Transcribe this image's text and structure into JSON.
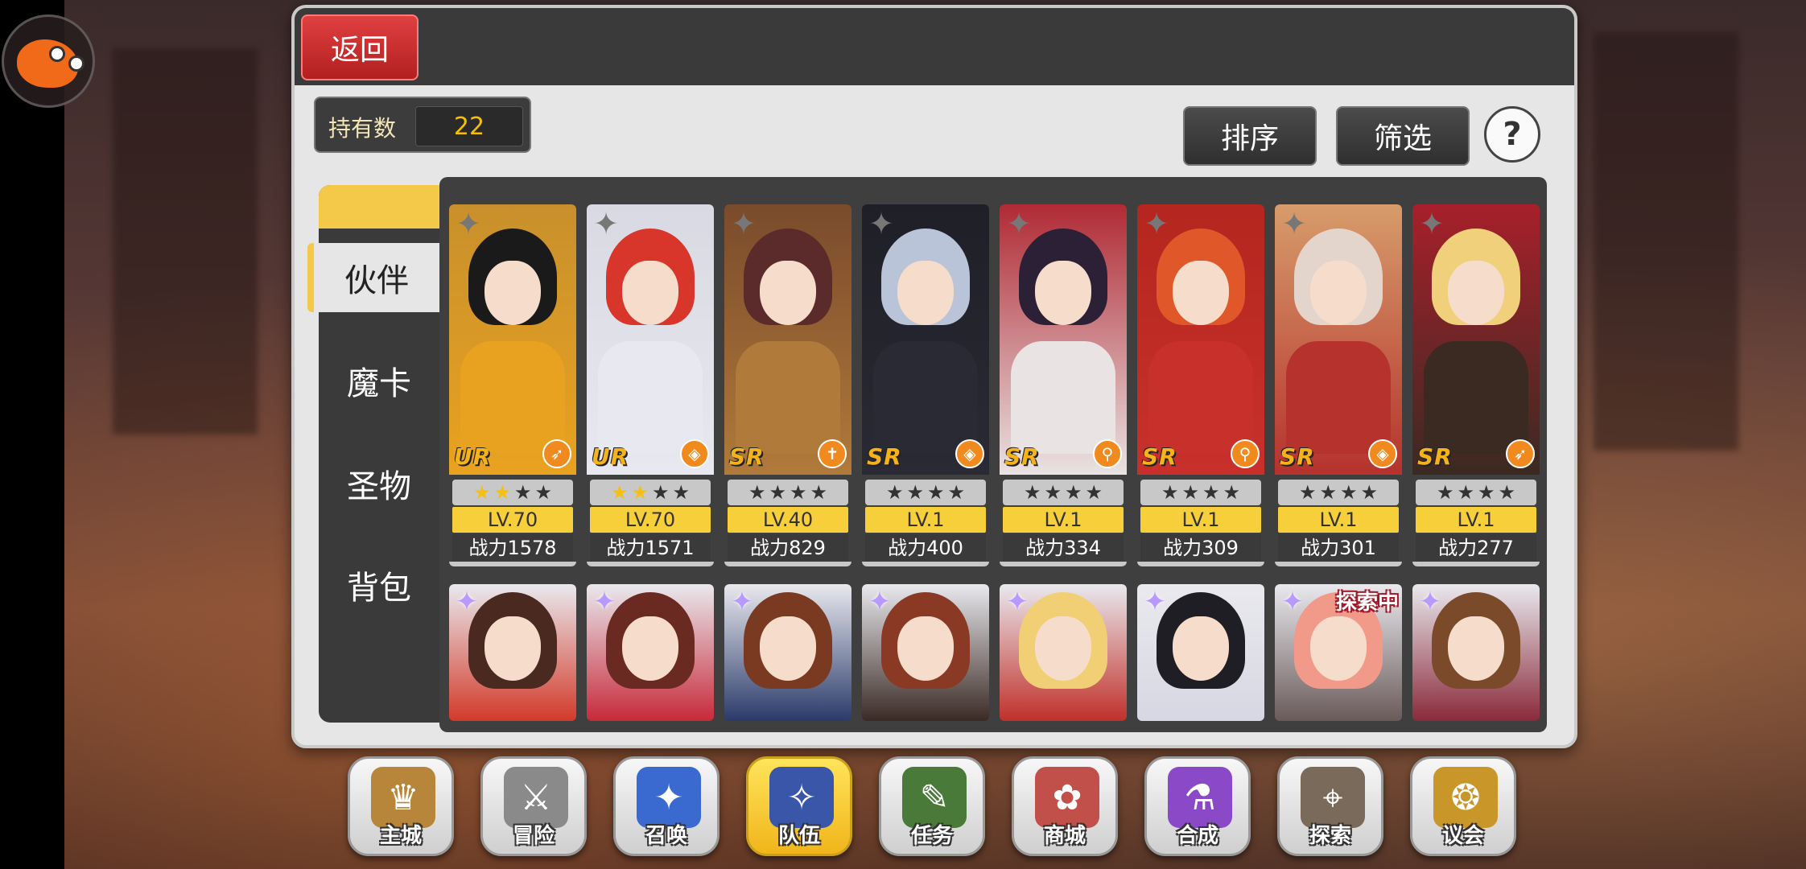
{
  "header": {
    "back_label": "返回"
  },
  "owned": {
    "label": "持有数",
    "value": "22"
  },
  "toolbar": {
    "sort_label": "排序",
    "filter_label": "筛选",
    "help_label": "?"
  },
  "side_tabs": [
    {
      "label": "伙伴",
      "active": true
    },
    {
      "label": "魔卡",
      "active": false
    },
    {
      "label": "圣物",
      "active": false
    },
    {
      "label": "背包",
      "active": false
    }
  ],
  "cards_row1": [
    {
      "rank": "UR",
      "stars_on": 2,
      "level": "LV.70",
      "power": "战力1578",
      "class_icon": "bow-icon",
      "palette": [
        "#1a1a1a",
        "#e9a21f",
        "#c8902c"
      ]
    },
    {
      "rank": "UR",
      "stars_on": 2,
      "level": "LV.70",
      "power": "战力1571",
      "class_icon": "shield-icon",
      "palette": [
        "#d8362b",
        "#e8e8f0",
        "#d9d9e3"
      ]
    },
    {
      "rank": "SR",
      "stars_on": 0,
      "level": "LV.40",
      "power": "战力829",
      "class_icon": "cross-icon",
      "palette": [
        "#5b2a2a",
        "#b07a3a",
        "#7a4b2c"
      ]
    },
    {
      "rank": "SR",
      "stars_on": 0,
      "level": "LV.1",
      "power": "战力400",
      "class_icon": "shield-icon",
      "palette": [
        "#b9c4d8",
        "#2a2a34",
        "#1f1f28"
      ]
    },
    {
      "rank": "SR",
      "stars_on": 0,
      "level": "LV.1",
      "power": "战力334",
      "class_icon": "wand-icon",
      "palette": [
        "#2b2035",
        "#e9e3e3",
        "#b02a34"
      ]
    },
    {
      "rank": "SR",
      "stars_on": 0,
      "level": "LV.1",
      "power": "战力309",
      "class_icon": "wand-icon",
      "palette": [
        "#e0572a",
        "#c8312b",
        "#b4261f"
      ]
    },
    {
      "rank": "SR",
      "stars_on": 0,
      "level": "LV.1",
      "power": "战力301",
      "class_icon": "shield-icon",
      "palette": [
        "#e3d5cc",
        "#b5322d",
        "#d79c6b"
      ]
    },
    {
      "rank": "SR",
      "stars_on": 0,
      "level": "LV.1",
      "power": "战力277",
      "class_icon": "bow-icon",
      "palette": [
        "#f0d07a",
        "#3a2a22",
        "#a7202b"
      ]
    }
  ],
  "cards_row2": [
    {
      "palette": [
        "#4a2a20",
        "#d23a2a"
      ],
      "tag": ""
    },
    {
      "palette": [
        "#6a2a22",
        "#c72a3a"
      ],
      "tag": ""
    },
    {
      "palette": [
        "#7a3a22",
        "#2a3a6a"
      ],
      "tag": ""
    },
    {
      "palette": [
        "#8a3a24",
        "#3a2a24"
      ],
      "tag": ""
    },
    {
      "palette": [
        "#f1cf74",
        "#c0302a"
      ],
      "tag": ""
    },
    {
      "palette": [
        "#1e1e24",
        "#d7d7e3"
      ],
      "tag": ""
    },
    {
      "palette": [
        "#f29a8a",
        "#6a5a5a"
      ],
      "tag": "探索中"
    },
    {
      "palette": [
        "#7a4a2a",
        "#8a2a3a"
      ],
      "tag": ""
    }
  ],
  "bottom_nav": [
    {
      "label": "主城",
      "icon": "crown-icon",
      "glyph": "♛",
      "color": "#b7863a",
      "active": false
    },
    {
      "label": "冒险",
      "icon": "crossed-swords-icon",
      "glyph": "⚔",
      "color": "#8a8a8a",
      "active": false
    },
    {
      "label": "召唤",
      "icon": "summon-card-icon",
      "glyph": "✦",
      "color": "#3a6ad0",
      "active": false
    },
    {
      "label": "队伍",
      "icon": "team-wings-icon",
      "glyph": "✧",
      "color": "#3a56a8",
      "active": true
    },
    {
      "label": "任务",
      "icon": "quest-book-icon",
      "glyph": "✎",
      "color": "#4a7a3a",
      "active": false
    },
    {
      "label": "商城",
      "icon": "shop-tree-icon",
      "glyph": "✿",
      "color": "#c2504a",
      "active": false
    },
    {
      "label": "合成",
      "icon": "synthesis-flask-icon",
      "glyph": "⚗",
      "color": "#8a4ac8",
      "active": false
    },
    {
      "label": "探索",
      "icon": "explore-compass-icon",
      "glyph": "⌖",
      "color": "#7a6a5a",
      "active": false
    },
    {
      "label": "议会",
      "icon": "council-crest-icon",
      "glyph": "❂",
      "color": "#c9962a",
      "active": false
    }
  ]
}
